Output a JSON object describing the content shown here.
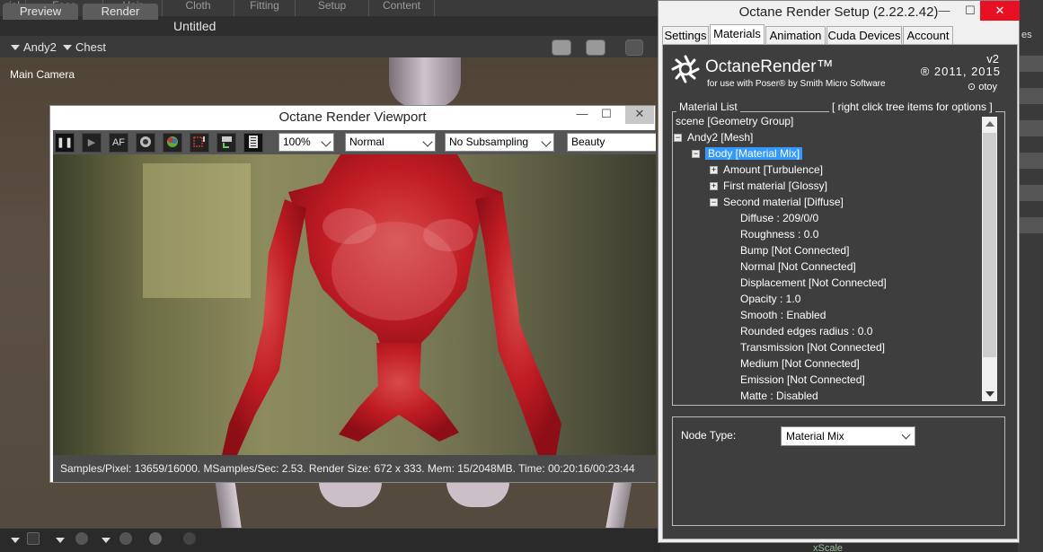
{
  "poser": {
    "top_tabs": [
      "rial",
      "Face",
      "Hair",
      "Cloth",
      "Fitting",
      "Setup",
      "Content"
    ],
    "doc_tabs": [
      "Preview",
      "Render"
    ],
    "doc_title": "Untitled",
    "figure_select": "Andy2",
    "part_select": "Chest",
    "camera_label": "Main Camera",
    "right_edge_text": "es",
    "xscale_label": "xScale"
  },
  "viewport": {
    "title": "Octane Render Viewport",
    "minimize": "—",
    "maximize": "☐",
    "close": "✕",
    "toolbar": {
      "pause": "❚❚",
      "play": "▶",
      "af_label": "AF",
      "zoom": "100%",
      "mode": "Normal",
      "subsampling": "No Subsampling",
      "pass": "Beauty"
    },
    "status": "Samples/Pixel: 13659/16000. MSamples/Sec: 2.53. Render Size: 672 x 333. Mem: 15/2048MB. Time: 00:20:16/00:23:44"
  },
  "octane": {
    "title": "Octane Render Setup (2.22.2.42)",
    "minimize": "—",
    "maximize": "☐",
    "close": "✕",
    "tabs": [
      "Settings",
      "Materials",
      "Animation",
      "Cuda Devices",
      "Account"
    ],
    "active_tab": "Materials",
    "logo": {
      "name": "OctaneRender™",
      "sub": "for use with Poser® by Smith Micro Software",
      "version": "v2",
      "copyright": "® 2011, 2015",
      "brand": "otoy"
    },
    "material_list_label": "Material List",
    "material_list_hint": "[ right click tree items for options ]",
    "tree": [
      {
        "label": "scene  [Geometry Group]",
        "level": 0,
        "toggle": ""
      },
      {
        "label": "Andy2  [Mesh]",
        "level": 1,
        "toggle": "−"
      },
      {
        "label": "Body  [Material Mix]",
        "level": 2,
        "toggle": "−",
        "selected": true
      },
      {
        "label": "Amount  [Turbulence]",
        "level": 3,
        "toggle": "+"
      },
      {
        "label": "First material  [Glossy]",
        "level": 3,
        "toggle": "+"
      },
      {
        "label": "Second material  [Diffuse]",
        "level": 3,
        "toggle": "−"
      },
      {
        "label": "Diffuse  :  209/0/0",
        "level": 4,
        "toggle": ""
      },
      {
        "label": "Roughness  :  0.0",
        "level": 4,
        "toggle": ""
      },
      {
        "label": "Bump   [Not Connected]",
        "level": 4,
        "toggle": ""
      },
      {
        "label": "Normal   [Not Connected]",
        "level": 4,
        "toggle": ""
      },
      {
        "label": "Displacement   [Not Connected]",
        "level": 4,
        "toggle": ""
      },
      {
        "label": "Opacity  :  1.0",
        "level": 4,
        "toggle": ""
      },
      {
        "label": "Smooth  :  Enabled",
        "level": 4,
        "toggle": ""
      },
      {
        "label": "Rounded edges radius  :  0.0",
        "level": 4,
        "toggle": ""
      },
      {
        "label": "Transmission   [Not Connected]",
        "level": 4,
        "toggle": ""
      },
      {
        "label": "Medium   [Not Connected]",
        "level": 4,
        "toggle": ""
      },
      {
        "label": "Emission   [Not Connected]",
        "level": 4,
        "toggle": ""
      },
      {
        "label": "Matte  :  Disabled",
        "level": 4,
        "toggle": ""
      }
    ],
    "node_type_label": "Node Type:",
    "node_type_value": "Material Mix"
  }
}
